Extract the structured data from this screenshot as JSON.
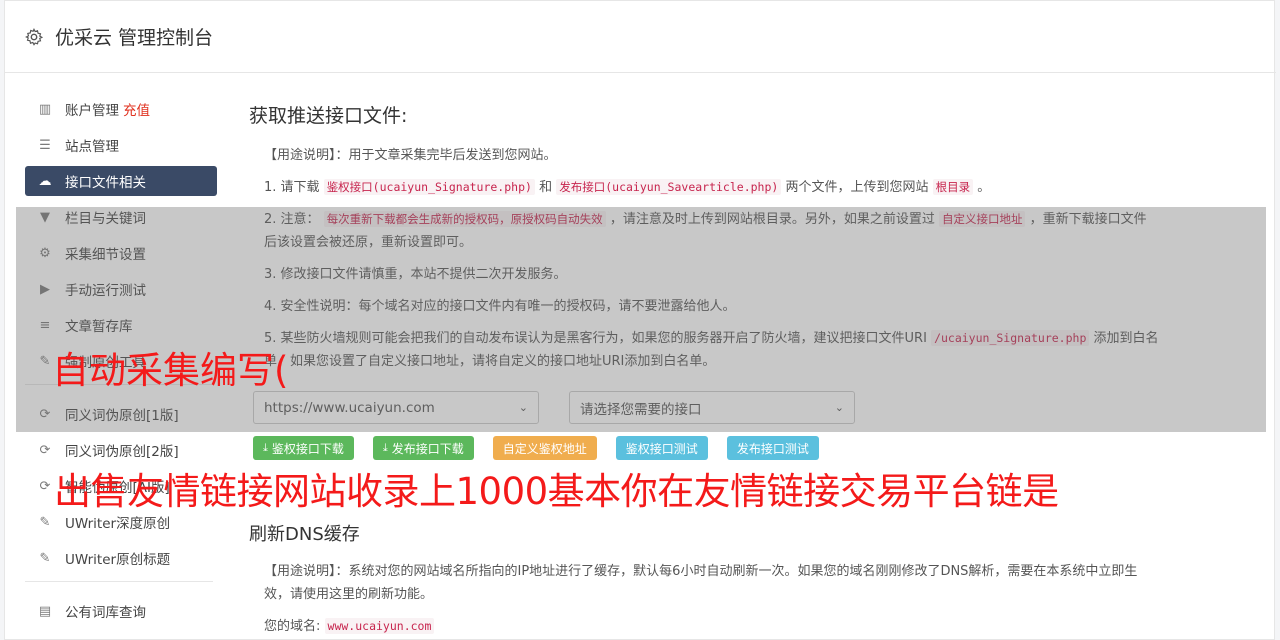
{
  "header": {
    "title": "优采云 管理控制台"
  },
  "sidebar": {
    "items": [
      {
        "icon": "bar-chart-icon",
        "glyph": "▥",
        "label": "账户管理",
        "extra": "充值"
      },
      {
        "icon": "server-icon",
        "glyph": "☰",
        "label": "站点管理"
      },
      {
        "icon": "cloud-upload-icon",
        "glyph": "☁",
        "label": "接口文件相关"
      },
      {
        "icon": "filter-icon",
        "glyph": "▼",
        "label": "栏目与关键词"
      },
      {
        "icon": "cogs-icon",
        "glyph": "⚙",
        "label": "采集细节设置"
      },
      {
        "icon": "play-icon",
        "glyph": "▶",
        "label": "手动运行测试"
      },
      {
        "icon": "database-icon",
        "glyph": "≡",
        "label": "文章暂存库"
      },
      {
        "icon": "edit-icon",
        "glyph": "✎",
        "label": "强制原创工具"
      }
    ],
    "items2": [
      {
        "icon": "refresh-icon",
        "glyph": "⟳",
        "label": "同义词伪原创[1版]"
      },
      {
        "icon": "refresh-icon",
        "glyph": "⟳",
        "label": "同义词伪原创[2版]"
      },
      {
        "icon": "refresh-icon",
        "glyph": "⟳",
        "label": "智能伪原创[AI版]"
      },
      {
        "icon": "edit-icon",
        "glyph": "✎",
        "label": "UWriter深度原创"
      },
      {
        "icon": "edit-icon",
        "glyph": "✎",
        "label": "UWriter原创标题"
      }
    ],
    "items3": [
      {
        "icon": "book-icon",
        "glyph": "▤",
        "label": "公有词库查询"
      }
    ]
  },
  "main": {
    "title": "获取推送接口文件:",
    "usage": "【用途说明】：用于文章采集完毕后发送到您网站。",
    "s1": {
      "a": "1. 请下载",
      "c1": "鉴权接口(ucaiyun_Signature.php)",
      "b": "和",
      "c2": "发布接口(ucaiyun_Savearticle.php)",
      "c": "两个文件，上传到您网站",
      "c3": "根目录",
      "d": "。"
    },
    "s2": {
      "a": "2. 注意：",
      "c1": "每次重新下载都会生成新的授权码，原授权码自动失效",
      "b": "，请注意及时上传到网站根目录。另外，如果之前设置过",
      "c2": "自定义接口地址",
      "c": "，重新下载接口文件后该设置会被还原，重新设置即可。"
    },
    "s3": "3. 修改接口文件请慎重，本站不提供二次开发服务。",
    "s4": "4. 安全性说明：每个域名对应的接口文件内有唯一的授权码，请不要泄露给他人。",
    "s5": {
      "a": "5. 某些防火墙规则可能会把我们的自动发布误认为是黑客行为，如果您的服务器开启了防火墙，建议把接口文件URI",
      "c1": "/ucaiyun_Signature.php",
      "b": "添加到白名单，如果您设置了自定义接口地址，请将自定义的接口地址URI添加到白名单。"
    },
    "site_select": "https://www.ucaiyun.com",
    "api_select": "请选择您需要的接口",
    "buttons": {
      "sig": "鉴权接口下载",
      "pub": "发布接口下载",
      "custom": "自定义鉴权地址",
      "test_sig": "鉴权接口测试",
      "test_pub": "发布接口测试"
    },
    "dns_title": "刷新DNS缓存",
    "dns_usage": "【用途说明】：系统对您的网站域名所指向的IP地址进行了缓存，默认每6小时自动刷新一次。如果您的域名刚刚修改了DNS解析，需要在本系统中立即生效，请使用这里的刷新功能。",
    "domain_label": "您的域名:",
    "domain_value": "www.ucaiyun.com"
  },
  "overlay": {
    "line1": "自动采集编写(",
    "line2": "出售友情链接网站收录上1000基本你在友情链接交易平台链是"
  },
  "colors": {
    "active_nav": "#3a4a66",
    "overlay_text": "#f41a1a",
    "recharge": "#e0301e"
  }
}
